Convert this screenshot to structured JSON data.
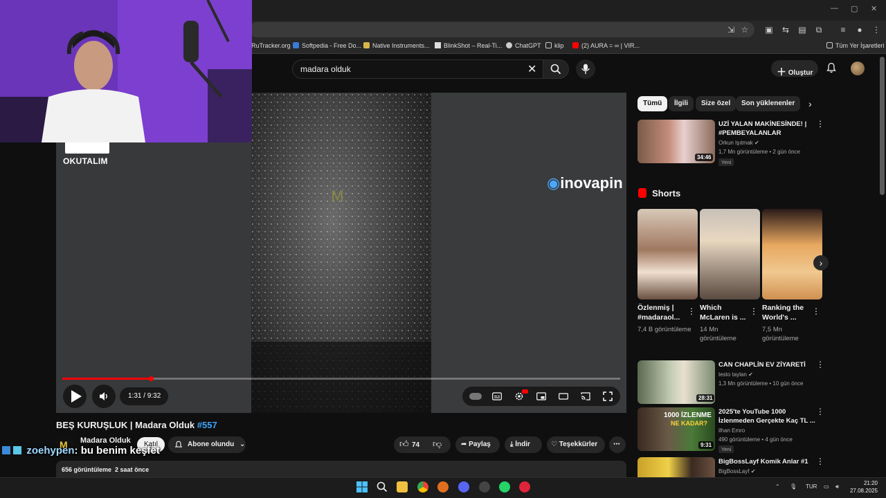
{
  "browser": {
    "bookmarks": [
      {
        "label": "RuTracker.org",
        "color": "#5b8bd6"
      },
      {
        "label": "Softpedia - Free Do...",
        "color": "#3a7bd5"
      },
      {
        "label": "Native Instruments...",
        "color": "#d8b64a"
      },
      {
        "label": "BlinkShot – Real-Ti...",
        "color": "#dddddd"
      },
      {
        "label": "ChatGPT",
        "color": "#cccccc"
      },
      {
        "label": "klip",
        "color": "#cccccc"
      },
      {
        "label": "(2) AURA = ∞ | VIR...",
        "color": "#ff0000"
      }
    ],
    "all_bookmarks": "Tüm Yer İşaretleri"
  },
  "header": {
    "search_query": "madara olduk",
    "create_label": "Oluştur"
  },
  "overlay": {
    "okutalim": "OKUTALIM",
    "sponsor": "inovapin",
    "chat_user": "zoehypen",
    "chat_message": ": bu benim keşfet"
  },
  "player": {
    "time": "1:31 / 9:32",
    "progress": 0.159
  },
  "video": {
    "title": "BEŞ KURUŞLUK | Madara Olduk",
    "hashtag": "#557",
    "channel": "Madara Olduk",
    "join_label": "Katıl",
    "subscribe_label": "Abone olundu",
    "likes": "74",
    "share_label": "Paylaş",
    "download_label": "İndir",
    "thanks_label": "Teşekkürler",
    "views": "656 görüntüleme",
    "age": "2 saat önce"
  },
  "sidebar": {
    "chips": [
      "Tümü",
      "İlgili",
      "Size özel",
      "Son yüklenenler"
    ],
    "shorts_label": "Shorts",
    "videos": [
      {
        "title": "UZİ YALAN MAKİNESİNDE! | #PEMBEYALANLAR",
        "channel": "Orkun Işıtmak",
        "meta": "1,7 Mn görüntüleme • 2 gün önce",
        "duration": "34:46",
        "badge": "Yeni"
      },
      {
        "title": "CAN CHAPLİN EV ZİYARETİ",
        "channel": "testo taylan",
        "meta": "1,3 Mn görüntüleme • 10 gün önce",
        "duration": "28:31",
        "badge": ""
      },
      {
        "title": "2025'te YouTube 1000 İzlenmeden Gerçekte Kaç TL ...",
        "channel": "ilhan Emro",
        "meta": "490 görüntüleme • 4 gün önce",
        "duration": "9:31",
        "badge": "Yeni"
      },
      {
        "title": "BigBossLayf Komik Anlar #1",
        "channel": "BigBossLayf",
        "meta": "",
        "duration": "",
        "badge": ""
      }
    ],
    "shorts": [
      {
        "title": "Özlenmiş | #madaraol...",
        "views": "7,4 B görüntüleme"
      },
      {
        "title": "Which McLaren is ...",
        "views": "14 Mn görüntüleme"
      },
      {
        "title": "Ranking the World's ...",
        "views": "7,5 Mn görüntüleme"
      }
    ]
  },
  "taskbar": {
    "lang": "TUR",
    "time": "21:20",
    "date": "27.08.2025"
  }
}
